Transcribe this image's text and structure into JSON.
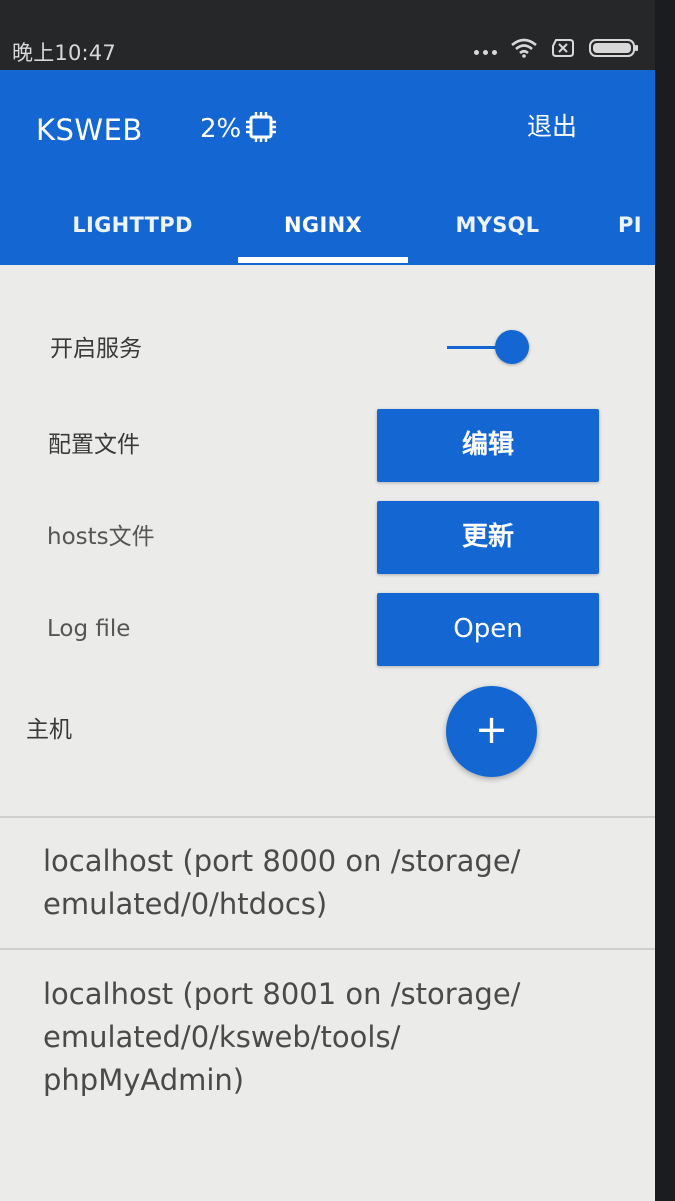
{
  "status_bar": {
    "time": "晚上10:47",
    "icons": [
      "more-dots-icon",
      "wifi-icon",
      "sim-off-icon",
      "battery-icon"
    ]
  },
  "app_bar": {
    "title": "KSWEB",
    "cpu_usage": "2%",
    "cpu_icon": "cpu-chip-icon",
    "exit_label": "退出",
    "accent_color": "#1467d2"
  },
  "tabs": [
    {
      "label": "LIGHTTPD",
      "active": false
    },
    {
      "label": "NGINX",
      "active": true
    },
    {
      "label": "MYSQL",
      "active": false
    },
    {
      "label": "PI",
      "active": false
    }
  ],
  "settings": {
    "service_label": "开启服务",
    "service_enabled": true,
    "config_label": "配置文件",
    "config_button": "编辑",
    "hosts_label": "hosts文件",
    "hosts_button": "更新",
    "log_label": "Log file",
    "log_button": "Open",
    "host_section_label": "主机",
    "add_host_button": "+"
  },
  "hosts": [
    {
      "line1": "localhost (port 8000 on /storage/",
      "line2": "emulated/0/htdocs)",
      "line3": ""
    },
    {
      "line1": "localhost (port 8001 on /storage/",
      "line2": "emulated/0/ksweb/tools/",
      "line3": "phpMyAdmin)"
    }
  ]
}
